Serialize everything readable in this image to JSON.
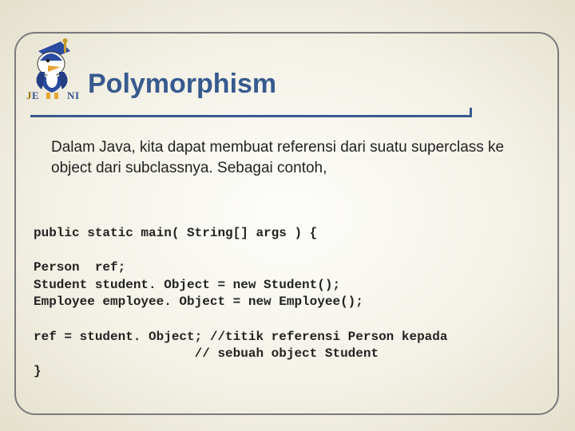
{
  "title": "Polymorphism",
  "paragraph": "Dalam Java, kita dapat membuat referensi dari suatu superclass ke object dari subclassnya. Sebagai contoh,",
  "code": "public static main( String[] args ) {\n\nPerson  ref;\nStudent student. Object = new Student();\nEmployee employee. Object = new Employee();\n\nref = student. Object; //titik referensi Person kepada\n                     // sebuah object Student\n}"
}
